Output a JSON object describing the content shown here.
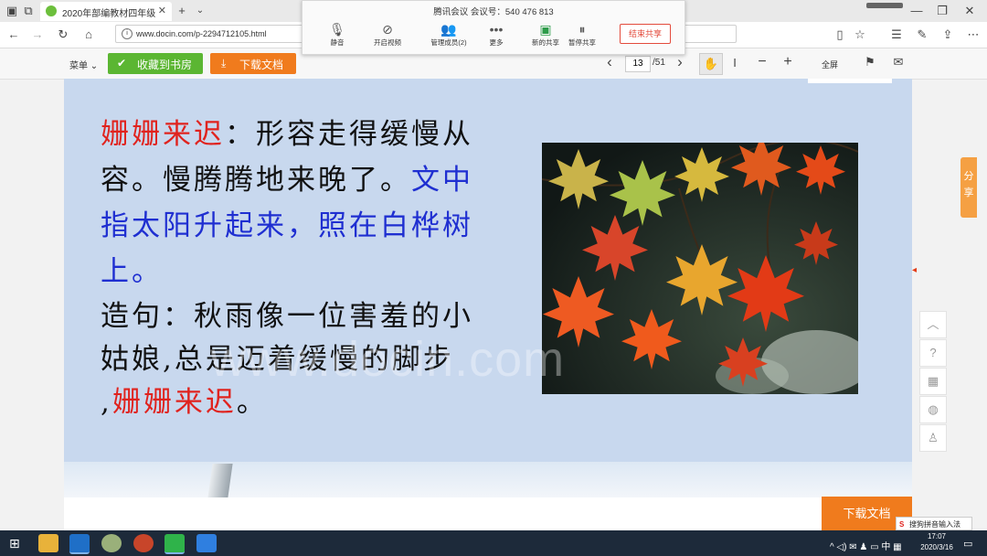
{
  "browser": {
    "tab_title": "2020年部编教材四年级",
    "url": "www.docin.com/p-2294712105.html"
  },
  "meeting": {
    "title": "腾讯会议 会议号：540 476 813",
    "tools": [
      "静音",
      "开启视频",
      "管理成员(2)",
      "更多",
      "新的共享",
      "暂停共享"
    ],
    "end_label": "结束共享"
  },
  "reader": {
    "menu_label": "菜单",
    "collect_label": "收藏到书房",
    "download_label": "下载文档",
    "current_page": "13",
    "total_pages": "/51",
    "fullscreen_label": "全屏",
    "share_label": "分享",
    "bottom_download": "下载文档"
  },
  "slide": {
    "term": "姗姗来迟",
    "colon": "：",
    "definition_line1": "形容走得缓慢从",
    "definition_line2": "容。慢腾腾地来晚了。",
    "context_line2": "文中",
    "context_line3": "指太阳升起来，照在白桦树",
    "context_line4": "上。",
    "sentence_line1": "造句：秋雨像一位害羞的小",
    "sentence_line2": "姑娘,总是迈着缓慢的脚步",
    "sentence_line3_prefix": ",",
    "sentence_term": "姗姗来迟",
    "sentence_end": "。",
    "watermark": "www.docin.com"
  },
  "taskbar": {
    "time": "17:07",
    "date": "2020/3/16",
    "ime": "搜狗拼音输入法"
  },
  "colors": {
    "accent_green": "#5bb632",
    "accent_orange": "#f07b1d",
    "term_red": "#e0231e",
    "context_blue": "#1f2fd1"
  }
}
